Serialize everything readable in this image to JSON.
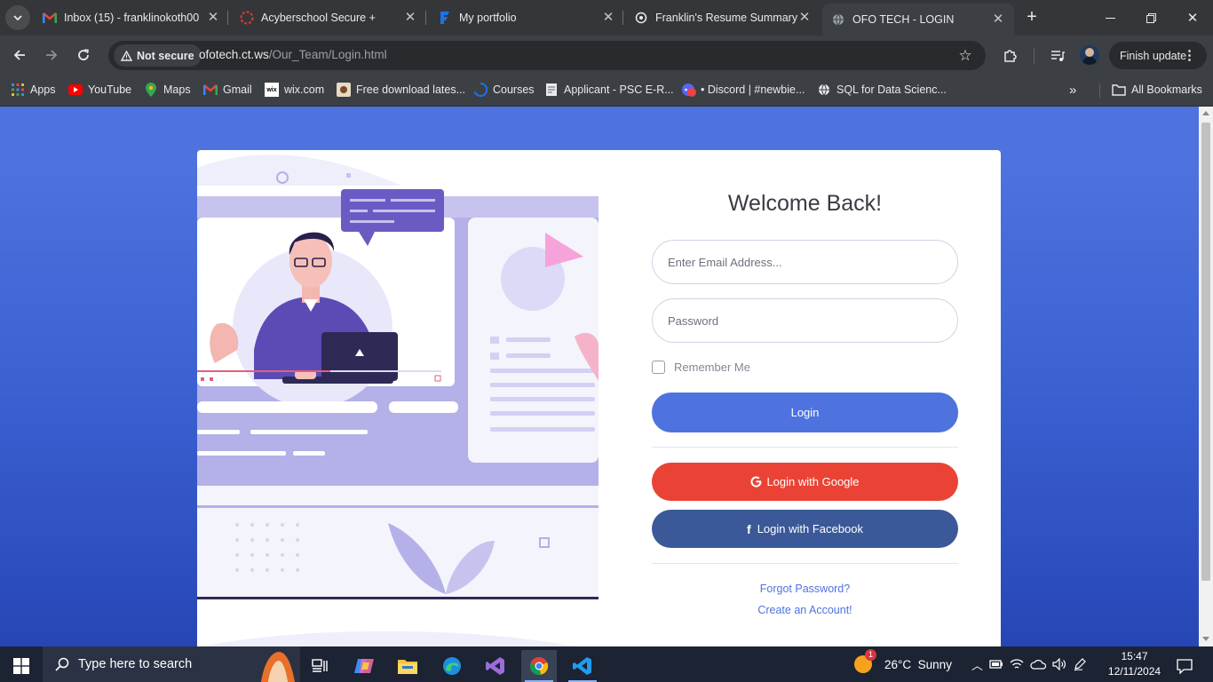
{
  "browser": {
    "tabs": [
      {
        "title": "Inbox (15) - franklinokoth00",
        "icon": "gmail-icon",
        "active": false
      },
      {
        "title": "Acyberschool Secure +",
        "icon": "acyberschool-icon",
        "active": false
      },
      {
        "title": "My portfolio",
        "icon": "portfolio-icon",
        "active": false
      },
      {
        "title": "Franklin's Resume Summary",
        "icon": "chatgpt-icon",
        "active": false
      },
      {
        "title": "OFO TECH - LOGIN",
        "icon": "globe-icon",
        "active": true
      }
    ],
    "new_tab_label": "+",
    "security_label": "Not secure",
    "url_domain": "ofotech.ct.ws",
    "url_path": "/Our_Team/Login.html",
    "finish_update_label": "Finish update",
    "bookmarks": [
      {
        "label": "Apps",
        "icon": "apps-grid-icon"
      },
      {
        "label": "YouTube",
        "icon": "youtube-icon"
      },
      {
        "label": "Maps",
        "icon": "maps-icon"
      },
      {
        "label": "Gmail",
        "icon": "gmail-icon"
      },
      {
        "label": "wix.com",
        "icon": "wix-icon"
      },
      {
        "label": "Free download lates...",
        "icon": "download-site-icon"
      },
      {
        "label": "Courses",
        "icon": "courses-icon"
      },
      {
        "label": "Applicant - PSC E-R...",
        "icon": "document-icon"
      },
      {
        "label": "• Discord | #newbie...",
        "icon": "discord-icon"
      },
      {
        "label": "SQL for Data Scienc...",
        "icon": "globe-icon"
      }
    ],
    "all_bookmarks_label": "All Bookmarks"
  },
  "login": {
    "heading": "Welcome Back!",
    "email_placeholder": "Enter Email Address...",
    "password_placeholder": "Password",
    "remember_label": "Remember Me",
    "login_button": "Login",
    "google_button": "Login with Google",
    "facebook_button": "Login with Facebook",
    "forgot_link": "Forgot Password?",
    "create_link": "Create an Account!"
  },
  "taskbar": {
    "search_placeholder": "Type here to search",
    "weather_badge": "1",
    "weather": "26°C  Sunny",
    "time": "15:47",
    "date": "12/11/2024"
  },
  "colors": {
    "page_bg": "#4e73df",
    "login_btn": "#4e73df",
    "google_btn": "#ea4335",
    "facebook_btn": "#3b5998"
  }
}
